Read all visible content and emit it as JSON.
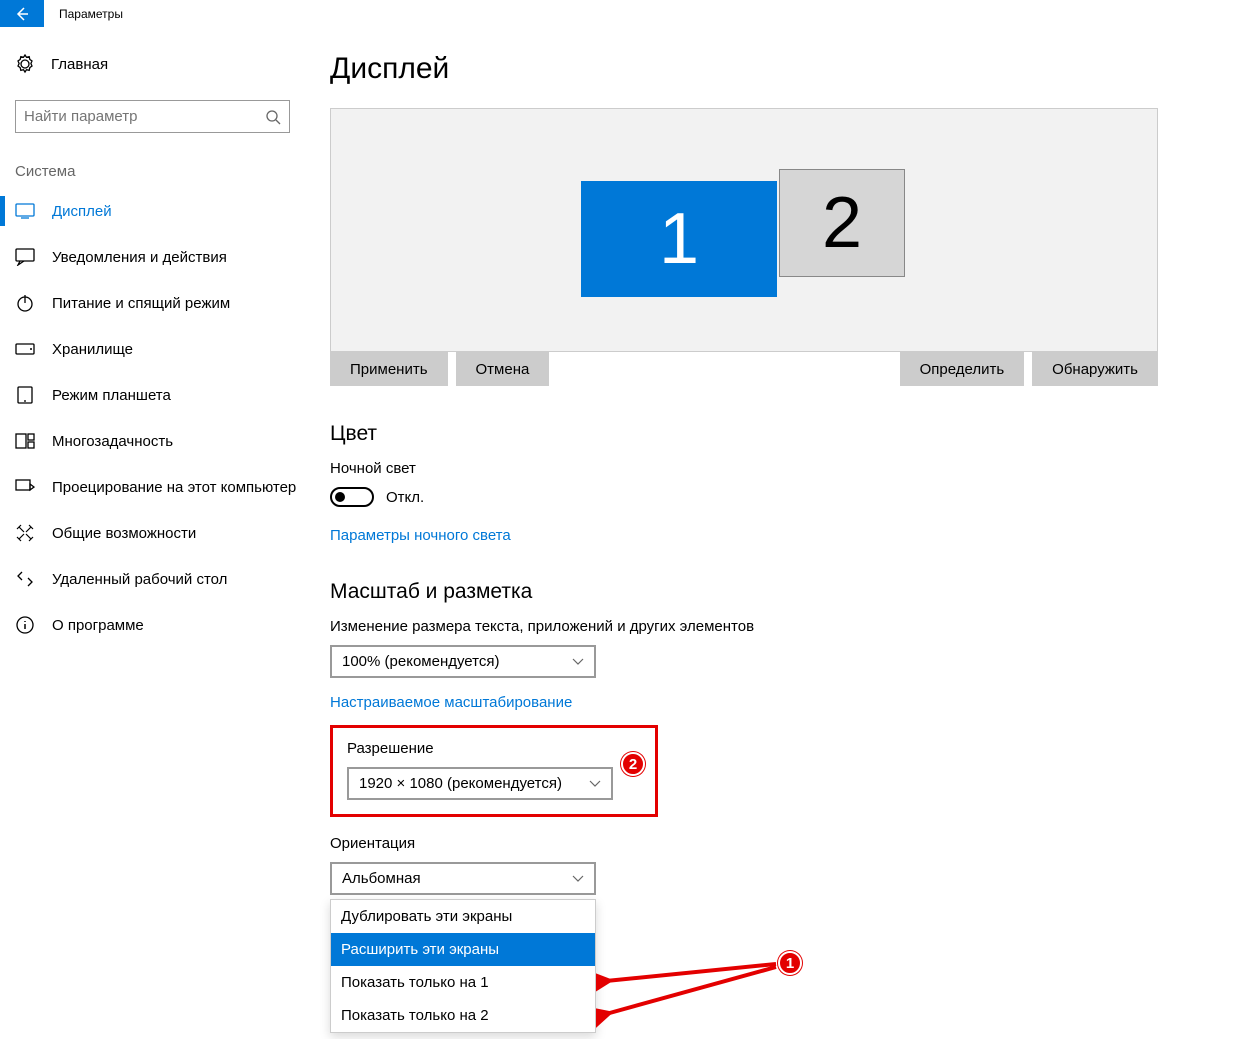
{
  "titlebar": {
    "title": "Параметры"
  },
  "sidebar": {
    "home": "Главная",
    "search_placeholder": "Найти параметр",
    "section": "Система",
    "items": [
      {
        "label": "Дисплей"
      },
      {
        "label": "Уведомления и действия"
      },
      {
        "label": "Питание и спящий режим"
      },
      {
        "label": "Хранилище"
      },
      {
        "label": "Режим планшета"
      },
      {
        "label": "Многозадачность"
      },
      {
        "label": "Проецирование на этот компьютер"
      },
      {
        "label": "Общие возможности"
      },
      {
        "label": "Удаленный рабочий стол"
      },
      {
        "label": "О программе"
      }
    ]
  },
  "main": {
    "title": "Дисплей",
    "monitors": {
      "m1": "1",
      "m2": "2"
    },
    "buttons": {
      "apply": "Применить",
      "cancel": "Отмена",
      "identify": "Определить",
      "detect": "Обнаружить"
    },
    "color_heading": "Цвет",
    "night_light_label": "Ночной свет",
    "night_light_state": "Откл.",
    "night_light_link": "Параметры ночного света",
    "scale_heading": "Масштаб и разметка",
    "scale_label": "Изменение размера текста, приложений и других элементов",
    "scale_value": "100% (рекомендуется)",
    "custom_scaling_link": "Настраиваемое масштабирование",
    "resolution_label": "Разрешение",
    "resolution_value": "1920 × 1080 (рекомендуется)",
    "orientation_label": "Ориентация",
    "orientation_value": "Альбомная",
    "multi_display_options": [
      "Дублировать эти экраны",
      "Расширить эти экраны",
      "Показать только на 1",
      "Показать только на 2"
    ]
  },
  "annotations": {
    "badge1": "1",
    "badge2": "2"
  }
}
